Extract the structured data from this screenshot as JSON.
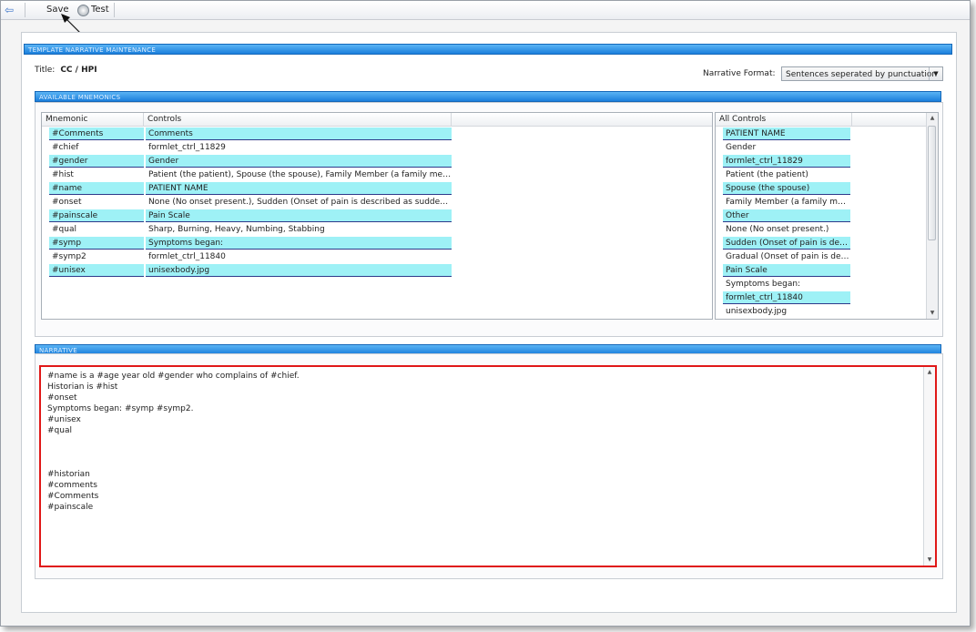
{
  "toolbar": {
    "save_label": "Save",
    "test_label": "Test"
  },
  "section_template": "TEMPLATE NARRATIVE MAINTENANCE",
  "title": {
    "label": "Title:",
    "value": "CC / HPI"
  },
  "narrative_format": {
    "label": "Narrative Format:",
    "selected": "Sentences seperated by punctuation"
  },
  "section_mnemonics": "AVAILABLE MNEMONICS",
  "mnemonics": {
    "columns": [
      "Mnemonic",
      "Controls"
    ],
    "rows": [
      {
        "mnemonic": "#Comments",
        "controls": "Comments",
        "highlight": true
      },
      {
        "mnemonic": "#chief",
        "controls": "formlet_ctrl_11829",
        "highlight": false
      },
      {
        "mnemonic": "#gender",
        "controls": "Gender",
        "highlight": true
      },
      {
        "mnemonic": "#hist",
        "controls": "Patient (the patient), Spouse (the spouse), Family Member (a family mem...",
        "highlight": false
      },
      {
        "mnemonic": "#name",
        "controls": "PATIENT NAME",
        "highlight": true
      },
      {
        "mnemonic": "#onset",
        "controls": "None (No onset present.), Sudden (Onset of pain is described as sudden)...",
        "highlight": false
      },
      {
        "mnemonic": "#painscale",
        "controls": "Pain Scale",
        "highlight": true
      },
      {
        "mnemonic": "#qual",
        "controls": "Sharp, Burning, Heavy, Numbing, Stabbing",
        "highlight": false
      },
      {
        "mnemonic": "#symp",
        "controls": "Symptoms began:",
        "highlight": true
      },
      {
        "mnemonic": "#symp2",
        "controls": "formlet_ctrl_11840",
        "highlight": false
      },
      {
        "mnemonic": "#unisex",
        "controls": "unisexbody.jpg",
        "highlight": true
      }
    ]
  },
  "all_controls": {
    "header": "All Controls",
    "rows": [
      {
        "label": "PATIENT NAME",
        "highlight": true
      },
      {
        "label": "Gender",
        "highlight": false
      },
      {
        "label": "formlet_ctrl_11829",
        "highlight": true
      },
      {
        "label": "Patient (the patient)",
        "highlight": false
      },
      {
        "label": "Spouse (the spouse)",
        "highlight": true
      },
      {
        "label": "Family Member (a family me...",
        "highlight": false
      },
      {
        "label": "Other",
        "highlight": true
      },
      {
        "label": "None (No onset present.)",
        "highlight": false
      },
      {
        "label": "Sudden (Onset of pain is des...",
        "highlight": true
      },
      {
        "label": "Gradual (Onset of pain is des...",
        "highlight": false
      },
      {
        "label": "Pain Scale",
        "highlight": true
      },
      {
        "label": "Symptoms began:",
        "highlight": false
      },
      {
        "label": "formlet_ctrl_11840",
        "highlight": true
      },
      {
        "label": "unisexbody.jpg",
        "highlight": false
      }
    ]
  },
  "section_narrative": "NARRATIVE",
  "narrative_lines": [
    "#name is a #age year old #gender who complains of #chief.",
    "Historian is #hist",
    "#onset",
    "Symptoms began: #symp #symp2.",
    "#unisex",
    "#qual",
    "",
    "",
    "",
    "#historian",
    "#comments",
    "#Comments",
    "#painscale"
  ]
}
